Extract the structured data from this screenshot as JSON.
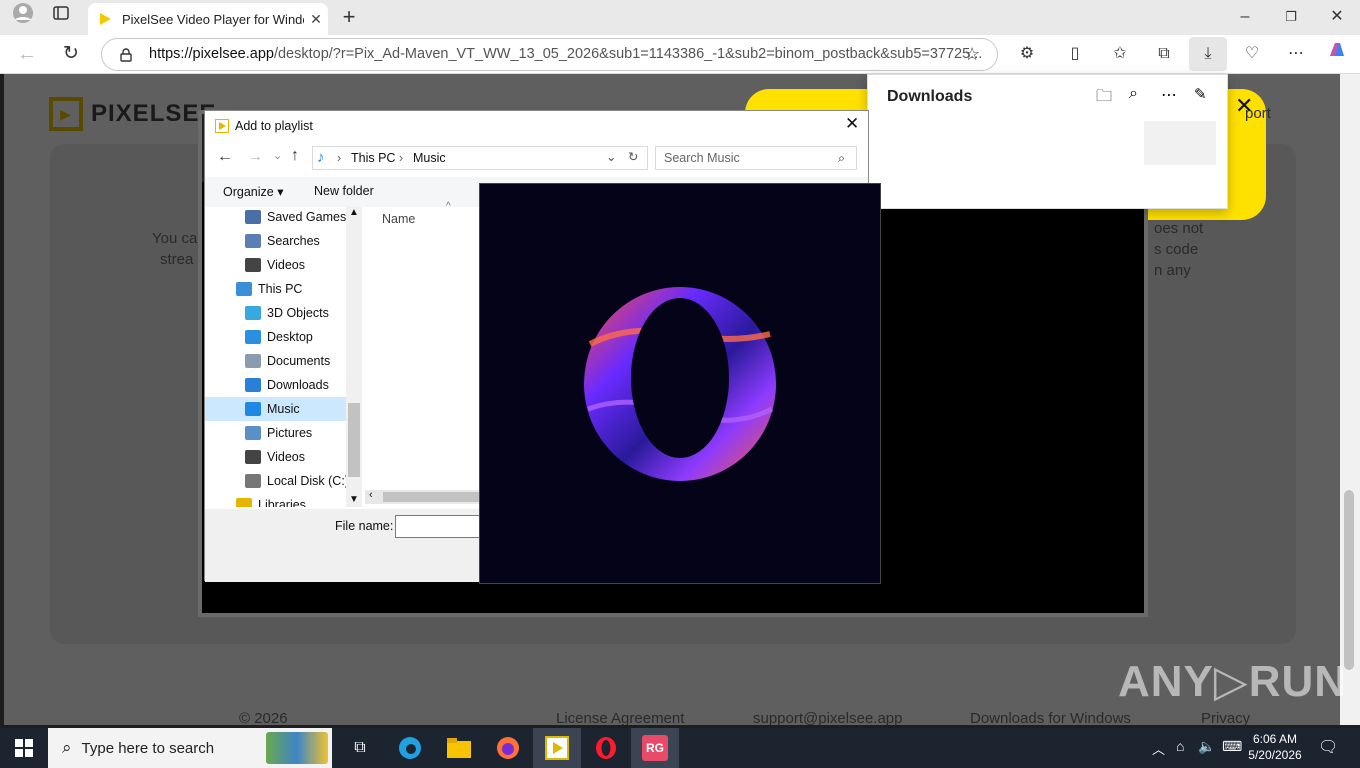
{
  "browser": {
    "tab_title": "PixelSee Video Player for Window",
    "url_host": "https://pixelsee.app",
    "url_path": "/desktop/?r=Pix_Ad-Maven_VT_WW_13_05_2026&sub1=1143386_-1&sub2=binom_postback&sub5=37725..."
  },
  "page": {
    "logo_text": "PIXELSEE",
    "body_left_1": "You ca",
    "body_left_2": "strea",
    "body_right_1": "oes not",
    "body_right_2": "s code",
    "body_right_3": "n any",
    "nav_right": "port",
    "footer": {
      "copyright": "© 2026",
      "license": "License Agreement",
      "email": "support@pixelsee.app",
      "downloads": "Downloads for Windows",
      "privacy": "Privacy"
    }
  },
  "downloads_panel": {
    "title": "Downloads"
  },
  "dialog": {
    "title": "Add to playlist",
    "breadcrumb": [
      "This PC",
      "Music"
    ],
    "search_placeholder": "Search Music",
    "organize_label": "Organize",
    "new_folder_label": "New folder",
    "column_name": "Name",
    "file_name_label": "File name:",
    "file_name_value": "",
    "tree_items": [
      {
        "label": "Saved Games",
        "icon": "saved-games-icon",
        "indent": 1
      },
      {
        "label": "Searches",
        "icon": "search-folder-icon",
        "indent": 1
      },
      {
        "label": "Videos",
        "icon": "videos-icon",
        "indent": 1
      },
      {
        "label": "This PC",
        "icon": "this-pc-icon",
        "indent": 0
      },
      {
        "label": "3D Objects",
        "icon": "3d-objects-icon",
        "indent": 1
      },
      {
        "label": "Desktop",
        "icon": "desktop-icon",
        "indent": 1
      },
      {
        "label": "Documents",
        "icon": "documents-icon",
        "indent": 1
      },
      {
        "label": "Downloads",
        "icon": "downloads-icon",
        "indent": 1
      },
      {
        "label": "Music",
        "icon": "music-icon",
        "indent": 1,
        "selected": true
      },
      {
        "label": "Pictures",
        "icon": "pictures-icon",
        "indent": 1
      },
      {
        "label": "Videos",
        "icon": "videos-icon",
        "indent": 1
      },
      {
        "label": "Local Disk (C:)",
        "icon": "local-disk-icon",
        "indent": 1
      },
      {
        "label": "Libraries",
        "icon": "libraries-icon",
        "indent": 0
      }
    ]
  },
  "taskbar": {
    "search_placeholder": "Type here to search",
    "time": "6:06 AM",
    "date": "5/20/2026",
    "pinned": [
      "task-view-icon",
      "edge-icon",
      "file-explorer-icon",
      "firefox-icon",
      "pixelsee-icon",
      "opera-icon",
      "rg-icon"
    ]
  },
  "colors": {
    "accent_yellow": "#ffe100",
    "opera_bg": "#050318",
    "taskbar": "#1c2430"
  }
}
